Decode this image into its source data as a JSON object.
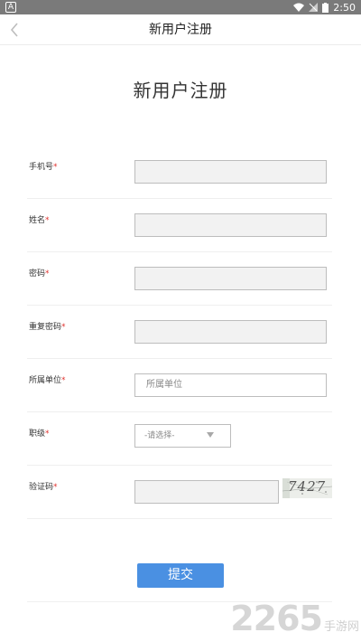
{
  "status_bar": {
    "app_icon_letter": "A",
    "time": "2:50"
  },
  "nav": {
    "title": "新用户注册"
  },
  "heading": "新用户注册",
  "required_mark": "*",
  "fields": [
    {
      "label": "手机号",
      "value": "",
      "placeholder": ""
    },
    {
      "label": "姓名",
      "value": "",
      "placeholder": ""
    },
    {
      "label": "密码",
      "value": "",
      "placeholder": ""
    },
    {
      "label": "重复密码",
      "value": "",
      "placeholder": ""
    },
    {
      "label": "所属单位",
      "value": "",
      "placeholder": "所属单位"
    }
  ],
  "level": {
    "label": "职级",
    "selected": "-请选择-"
  },
  "captcha": {
    "label": "验证码",
    "value": "",
    "image_text": "7427"
  },
  "submit_label": "提交",
  "watermark": {
    "number": "2265",
    "text": "手游网"
  }
}
